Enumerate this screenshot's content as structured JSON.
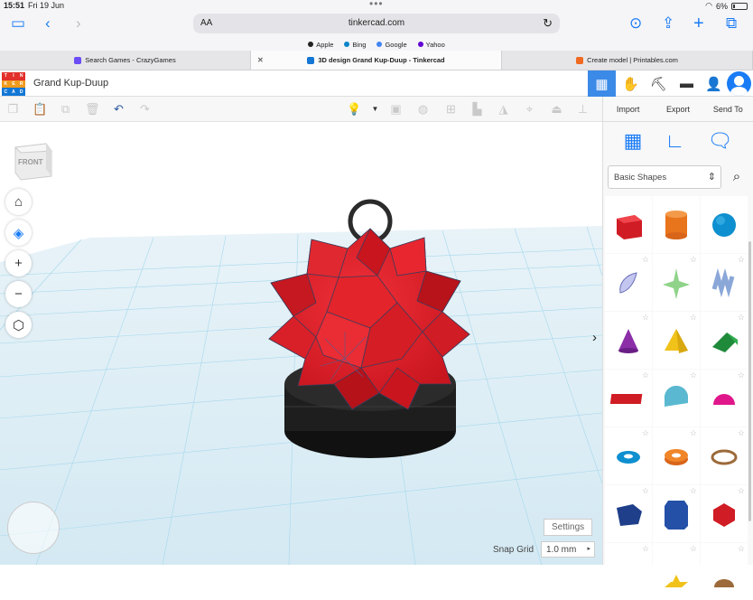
{
  "status": {
    "time": "15:51",
    "date": "Fri 19 Jun",
    "battery": "6%"
  },
  "safari": {
    "aa": "AA",
    "url": "tinkercad.com"
  },
  "favorites": [
    {
      "label": "Apple",
      "color": "#222"
    },
    {
      "label": "Bing",
      "color": "#0a84c9"
    },
    {
      "label": "Google",
      "color": "#4285f4"
    },
    {
      "label": "Yahoo",
      "color": "#6001d2"
    }
  ],
  "tabs": [
    {
      "label": "Search Games - CrazyGames",
      "color": "#6b4cf6"
    },
    {
      "label": "3D design Grand Kup-Duup - Tinkercad",
      "color": "#1477d4"
    },
    {
      "label": "Create model | Printables.com",
      "color": "#f06a22"
    }
  ],
  "logo": [
    "TIN",
    "KER",
    "CAD"
  ],
  "design_title": "Grand Kup-Duup",
  "panel_tabs": [
    "Import",
    "Export",
    "Send To"
  ],
  "shape_category": "Basic Shapes",
  "viewcube_label": "FRONT",
  "settings_label": "Settings",
  "snap_grid": {
    "label": "Snap Grid",
    "value": "1.0 mm"
  },
  "colors": {
    "accent": "#3b8ae8",
    "model_red": "#e3242b",
    "base": "#222222",
    "grid": "#a6d8ec"
  }
}
